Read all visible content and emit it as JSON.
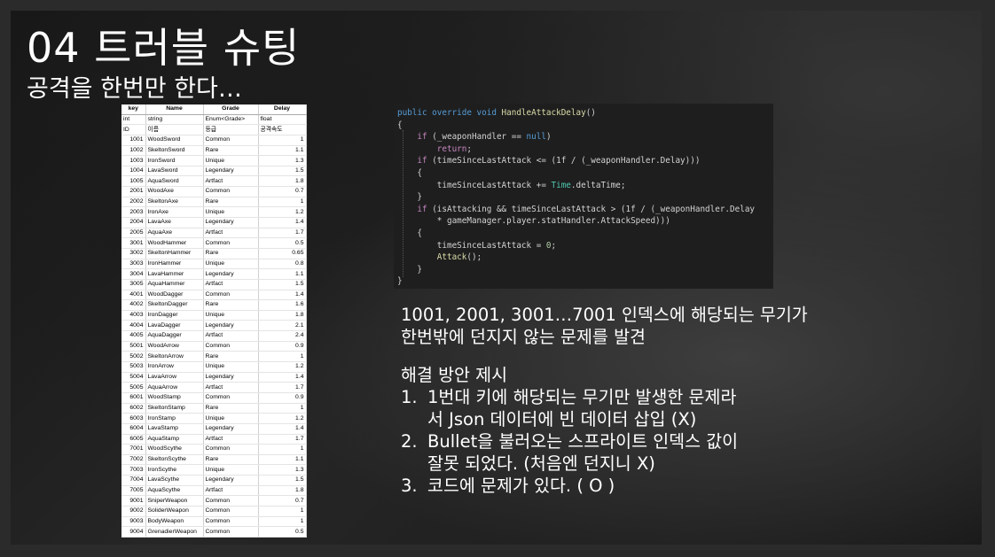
{
  "slide": {
    "title": "04 트러블 슈팅",
    "subtitle": "공격을 한번만 한다…"
  },
  "table": {
    "headers": [
      "key",
      "Name",
      "Grade",
      "Delay"
    ],
    "types": [
      "int",
      "string",
      "Enum<Grade>",
      "float"
    ],
    "labels": [
      "ID",
      "이름",
      "등급",
      "공격속도"
    ],
    "rows": [
      [
        "1001",
        "WoodSword",
        "Common",
        "1"
      ],
      [
        "1002",
        "SkeltonSword",
        "Rare",
        "1.1"
      ],
      [
        "1003",
        "IronSword",
        "Unique",
        "1.3"
      ],
      [
        "1004",
        "LavaSword",
        "Legendary",
        "1.5"
      ],
      [
        "1005",
        "AquaSword",
        "Artfact",
        "1.8"
      ],
      [
        "2001",
        "WoodAxe",
        "Common",
        "0.7"
      ],
      [
        "2002",
        "SkeltonAxe",
        "Rare",
        "1"
      ],
      [
        "2003",
        "IronAxe",
        "Unique",
        "1.2"
      ],
      [
        "2004",
        "LavaAxe",
        "Legendary",
        "1.4"
      ],
      [
        "2005",
        "AquaAxe",
        "Artfact",
        "1.7"
      ],
      [
        "3001",
        "WoodHammer",
        "Common",
        "0.5"
      ],
      [
        "3002",
        "SkeltonHammer",
        "Rare",
        "0.65"
      ],
      [
        "3003",
        "IronHammer",
        "Unique",
        "0.8"
      ],
      [
        "3004",
        "LavaHammer",
        "Legendary",
        "1.1"
      ],
      [
        "3005",
        "AquaHammer",
        "Artfact",
        "1.5"
      ],
      [
        "4001",
        "WoodDagger",
        "Common",
        "1.4"
      ],
      [
        "4002",
        "SkeltonDagger",
        "Rare",
        "1.6"
      ],
      [
        "4003",
        "IronDagger",
        "Unique",
        "1.8"
      ],
      [
        "4004",
        "LavaDagger",
        "Legendary",
        "2.1"
      ],
      [
        "4005",
        "AquaDagger",
        "Artfact",
        "2.4"
      ],
      [
        "5001",
        "WoodArrow",
        "Common",
        "0.9"
      ],
      [
        "5002",
        "SkeltonArrow",
        "Rare",
        "1"
      ],
      [
        "5003",
        "IronArrow",
        "Unique",
        "1.2"
      ],
      [
        "5004",
        "LavaArrow",
        "Legendary",
        "1.4"
      ],
      [
        "5005",
        "AquaArrow",
        "Artfact",
        "1.7"
      ],
      [
        "6001",
        "WoodStamp",
        "Common",
        "0.9"
      ],
      [
        "6002",
        "SkeltonStamp",
        "Rare",
        "1"
      ],
      [
        "6003",
        "IronStamp",
        "Unique",
        "1.2"
      ],
      [
        "6004",
        "LavaStamp",
        "Legendary",
        "1.4"
      ],
      [
        "6005",
        "AquaStamp",
        "Artfact",
        "1.7"
      ],
      [
        "7001",
        "WoodScythe",
        "Common",
        "1"
      ],
      [
        "7002",
        "SkeltonScythe",
        "Rare",
        "1.1"
      ],
      [
        "7003",
        "IronScythe",
        "Unique",
        "1.3"
      ],
      [
        "7004",
        "LavaScythe",
        "Legendary",
        "1.5"
      ],
      [
        "7005",
        "AquaScythe",
        "Artfact",
        "1.8"
      ],
      [
        "9001",
        "SniperWeapon",
        "Common",
        "0.7"
      ],
      [
        "9002",
        "SoliderWeapon",
        "Common",
        "1"
      ],
      [
        "9003",
        "BodyWeapon",
        "Common",
        "1"
      ],
      [
        "9004",
        "GrenadierWeapon",
        "Common",
        "0.5"
      ]
    ]
  },
  "code": {
    "lines": [
      [
        [
          "kw",
          "public override void "
        ],
        [
          "fn",
          "HandleAttackDelay"
        ],
        [
          "",
          "()"
        ]
      ],
      [
        [
          "",
          "{"
        ]
      ],
      [
        [
          "",
          "    "
        ],
        [
          "kw2",
          "if"
        ],
        [
          "",
          " (_weaponHandler == "
        ],
        [
          "kw",
          "null"
        ],
        [
          "",
          ")"
        ]
      ],
      [
        [
          "",
          "        "
        ],
        [
          "kw2",
          "return"
        ],
        [
          "",
          ";"
        ]
      ],
      [
        [
          "",
          "    "
        ],
        [
          "kw2",
          "if"
        ],
        [
          "",
          " (timeSinceLastAttack <= (1f / (_weaponHandler.Delay)))"
        ]
      ],
      [
        [
          "",
          "    {"
        ]
      ],
      [
        [
          "",
          "        timeSinceLastAttack += "
        ],
        [
          "ty",
          "Time"
        ],
        [
          "",
          ".deltaTime;"
        ]
      ],
      [
        [
          "",
          "    }"
        ]
      ],
      [
        [
          "",
          "    "
        ],
        [
          "kw2",
          "if"
        ],
        [
          "",
          " (isAttacking && timeSinceLastAttack > (1f / (_weaponHandler.Delay"
        ]
      ],
      [
        [
          "",
          "        * gameManager.player.statHandler.AttackSpeed)))"
        ]
      ],
      [
        [
          "",
          "    {"
        ]
      ],
      [
        [
          "",
          "        timeSinceLastAttack = "
        ],
        [
          "nm",
          "0"
        ],
        [
          "",
          ";"
        ]
      ],
      [
        [
          "",
          "        "
        ],
        [
          "fn",
          "Attack"
        ],
        [
          "",
          "();"
        ]
      ],
      [
        [
          "",
          "    }"
        ]
      ],
      [
        [
          "",
          "}"
        ]
      ]
    ]
  },
  "description": {
    "line1": "1001, 2001, 3001…7001 인덱스에 해당되는 무기가",
    "line2": "한번밖에 던지지 않는 문제를 발견",
    "solution_title": "해결 방안 제시",
    "items": [
      {
        "num": "1.",
        "lines": [
          "1번대 키에 해당되는 무기만 발생한 문제라",
          "서 Json 데이터에 빈 데이터 삽입 (X)"
        ]
      },
      {
        "num": "2.",
        "lines": [
          "Bullet을 불러오는 스프라이트 인덱스 값이",
          "잘못 되었다. (처음엔 던지니 X)"
        ]
      },
      {
        "num": "3.",
        "lines": [
          "코드에 문제가 있다. ( O )"
        ]
      }
    ]
  }
}
